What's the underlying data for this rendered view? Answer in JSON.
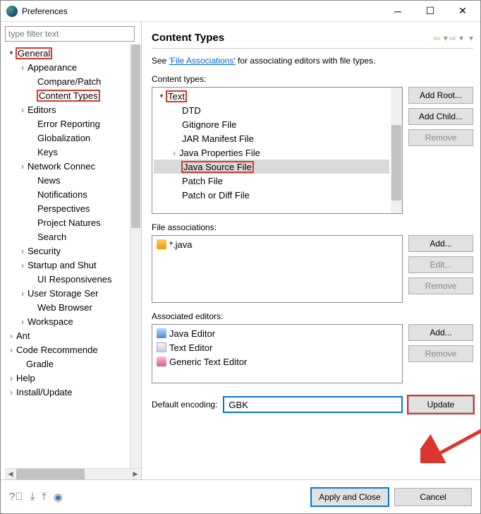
{
  "window": {
    "title": "Preferences"
  },
  "filter": {
    "placeholder": "type filter text"
  },
  "nav": {
    "general": "General",
    "items": [
      "Appearance",
      "Compare/Patch",
      "Content Types",
      "Editors",
      "Error Reporting",
      "Globalization",
      "Keys",
      "Network Connec",
      "News",
      "Notifications",
      "Perspectives",
      "Project Natures",
      "Search",
      "Security",
      "Startup and Shut",
      "UI Responsivenes",
      "User Storage Ser",
      "Web Browser",
      "Workspace"
    ],
    "ant": "Ant",
    "code": "Code Recommende",
    "gradle": "Gradle",
    "help": "Help",
    "install": "Install/Update"
  },
  "header": {
    "title": "Content Types"
  },
  "desc": {
    "pre": "See ",
    "link": "'File Associations'",
    "post": " for associating editors with file types."
  },
  "sections": {
    "content_types": "Content types:",
    "file_assoc": "File associations:",
    "assoc_editors": "Associated editors:",
    "default_enc": "Default encoding:"
  },
  "content_tree": {
    "root": "Text",
    "items": [
      "DTD",
      "Gitignore File",
      "JAR Manifest File",
      "Java Properties File",
      "Java Source File",
      "Patch File",
      "Patch or Diff File"
    ]
  },
  "file_assoc_items": [
    "*.java"
  ],
  "editors": [
    "Java Editor",
    "Text Editor",
    "Generic Text Editor"
  ],
  "buttons": {
    "add_root": "Add Root...",
    "add_child": "Add Child...",
    "remove": "Remove",
    "add": "Add...",
    "edit": "Edit...",
    "update": "Update",
    "apply": "Apply and Close",
    "cancel": "Cancel"
  },
  "encoding": {
    "value": "GBK"
  }
}
